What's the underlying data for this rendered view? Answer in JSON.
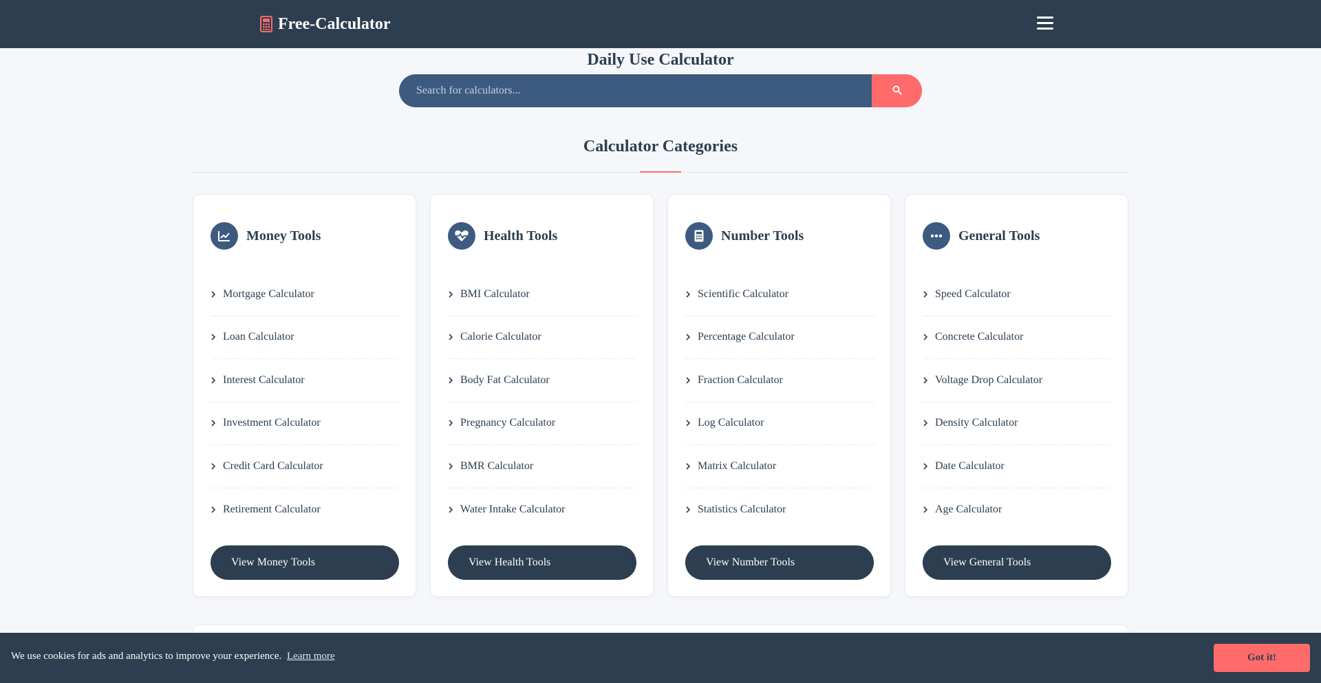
{
  "header": {
    "brand": "Free-Calculator",
    "brand_icon": "calculator-icon",
    "brand_color": "#ff6b6b",
    "menu_icon": "hamburger-menu-icon",
    "background": "#2c3e50"
  },
  "hero": {
    "title": "Daily Use Calculator",
    "search_placeholder": "Search for calculators...",
    "search_icon": "search-icon"
  },
  "categories": {
    "title": "Calculator Categories",
    "cards": [
      {
        "title": "Money Tools",
        "icon": "chart-line-icon",
        "items": [
          "Mortgage Calculator",
          "Loan Calculator",
          "Interest Calculator",
          "Investment Calculator",
          "Credit Card Calculator",
          "Retirement Calculator"
        ],
        "button": "View Money Tools"
      },
      {
        "title": "Health Tools",
        "icon": "heartbeat-icon",
        "items": [
          "BMI Calculator",
          "Calorie Calculator",
          "Body Fat Calculator",
          "Pregnancy Calculator",
          "BMR Calculator",
          "Water Intake Calculator"
        ],
        "button": "View Health Tools"
      },
      {
        "title": "Number Tools",
        "icon": "calculator-icon",
        "items": [
          "Scientific Calculator",
          "Percentage Calculator",
          "Fraction Calculator",
          "Log Calculator",
          "Matrix Calculator",
          "Statistics Calculator"
        ],
        "button": "View Number Tools"
      },
      {
        "title": "General Tools",
        "icon": "ellipsis-icon",
        "items": [
          "Speed Calculator",
          "Concrete Calculator",
          "Voltage Drop Calculator",
          "Density Calculator",
          "Date Calculator",
          "Age Calculator"
        ],
        "button": "View General Tools"
      }
    ]
  },
  "cookie": {
    "text": "We use cookies for ads and analytics to improve your experience.",
    "link": "Learn more",
    "button": "Got it!"
  },
  "colors": {
    "primary": "#2c3e50",
    "accent": "#ff6b6b",
    "search_bg": "#3d5a80",
    "page_bg": "#f5f7fa"
  }
}
